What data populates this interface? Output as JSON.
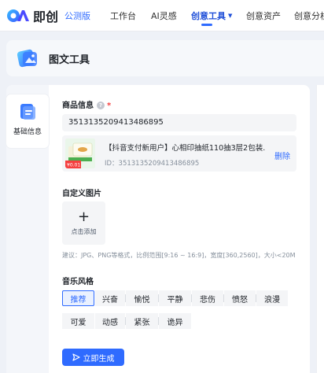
{
  "app": {
    "logo_text": "即创",
    "beta_label": "公测版"
  },
  "nav": {
    "items": [
      "工作台",
      "AI灵感",
      "创意工具",
      "创意资产",
      "创意分析"
    ],
    "active": "创意工具"
  },
  "page": {
    "title": "图文工具"
  },
  "sidebar": {
    "tab_label": "基础信息"
  },
  "product_info": {
    "label": "商品信息",
    "required_mark": "*",
    "help_mark": "?",
    "input_value": "3513135209413486895",
    "product": {
      "title": "【抖音支付新用户】心相印抽纸110抽3层2包装...",
      "id_text": "ID：3513135209413486895",
      "delete_label": "删除",
      "thumb_tag": "¥0.01"
    }
  },
  "custom_image": {
    "label": "自定义图片",
    "plus": "+",
    "upload_text": "点击添加",
    "hint": "建议：JPG、PNG等格式，比例范围[9:16 ~ 16:9]，宽度[360,2560]，大小<20M"
  },
  "music": {
    "label": "音乐风格",
    "row1": [
      "推荐",
      "兴奋",
      "愉悦",
      "平静",
      "悲伤",
      "愤怒",
      "浪漫"
    ],
    "row2": [
      "可爱",
      "动感",
      "紧张",
      "诡异"
    ],
    "selected": "推荐"
  },
  "actions": {
    "generate_label": "立即生成"
  },
  "colors": {
    "accent": "#2f6bff",
    "danger": "#f53f3f",
    "background": "#eef1f7"
  }
}
